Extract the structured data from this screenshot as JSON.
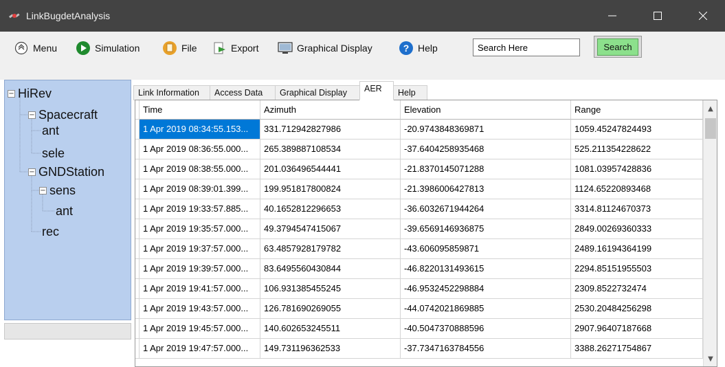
{
  "window": {
    "title": "LinkBugdetAnalysis",
    "controls": {
      "minimize": "—",
      "maximize": "☐",
      "close": "✕"
    }
  },
  "toolbar": {
    "menu_label": "Menu",
    "simulation_label": "Simulation",
    "file_label": "File",
    "export_label": "Export",
    "graphical_display_label": "Graphical Display",
    "help_label": "Help",
    "search_value": "Search Here",
    "search_button_label": "Search"
  },
  "tree": {
    "root": "HiRev",
    "spacecraft": "Spacecraft",
    "spacecraft_ant": "ant",
    "spacecraft_sele": "sele",
    "gndstation": "GNDStation",
    "sens": "sens",
    "sens_ant": "ant",
    "rec": "rec",
    "expand_sign": "−"
  },
  "tabs": [
    "Link Information",
    "Access Data",
    "Graphical Display",
    "AER",
    "Help"
  ],
  "active_tab": "AER",
  "grid": {
    "columns": [
      "Time",
      "Azimuth",
      "Elevation",
      "Range"
    ],
    "rows": [
      [
        "1 Apr 2019 08:34:55.153...",
        "331.712942827986",
        "-20.9743848369871",
        "1059.45247824493"
      ],
      [
        "1 Apr 2019 08:36:55.000...",
        "265.389887108534",
        "-37.6404258935468",
        "525.211354228622"
      ],
      [
        "1 Apr 2019 08:38:55.000...",
        "201.036496544441",
        "-21.8370145071288",
        "1081.03957428836"
      ],
      [
        "1 Apr 2019 08:39:01.399...",
        "199.951817800824",
        "-21.3986006427813",
        "1124.65220893468"
      ],
      [
        "1 Apr 2019 19:33:57.885...",
        "40.1652812296653",
        "-36.6032671944264",
        "3314.81124670373"
      ],
      [
        "1 Apr 2019 19:35:57.000...",
        "49.3794547415067",
        "-39.6569146936875",
        "2849.00269360333"
      ],
      [
        "1 Apr 2019 19:37:57.000...",
        "63.4857928179782",
        "-43.606095859871",
        "2489.16194364199"
      ],
      [
        "1 Apr 2019 19:39:57.000...",
        "83.6495560430844",
        "-46.8220131493615",
        "2294.85151955503"
      ],
      [
        "1 Apr 2019 19:41:57.000...",
        "106.931385455245",
        "-46.9532452298884",
        "2309.8522732474"
      ],
      [
        "1 Apr 2019 19:43:57.000...",
        "126.781690269055",
        "-44.0742021869885",
        "2530.20484256298"
      ],
      [
        "1 Apr 2019 19:45:57.000...",
        "140.602653245511",
        "-40.5047370888596",
        "2907.96407187668"
      ],
      [
        "1 Apr 2019 19:47:57.000...",
        "149.731196362533",
        "-37.7347163784556",
        "3388.26271754867"
      ]
    ],
    "scroll_up": "▲",
    "scroll_down": "▼"
  },
  "colors": {
    "titlebar": "#434343",
    "tree_background": "#b9cfee",
    "selection": "#0078d7",
    "search_button": "#8ce08c"
  },
  "icons": {
    "app": "satellite-icon",
    "menu": "menu-circle-icon",
    "simulation": "play-icon",
    "file": "file-icon",
    "export": "export-icon",
    "graphical_display": "monitor-icon",
    "help": "help-icon"
  }
}
